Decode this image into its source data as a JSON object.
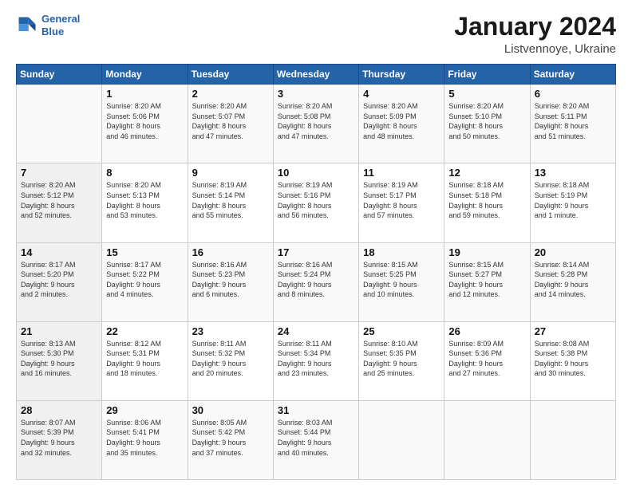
{
  "logo": {
    "line1": "General",
    "line2": "Blue"
  },
  "title": "January 2024",
  "subtitle": "Listvennoye, Ukraine",
  "days_header": [
    "Sunday",
    "Monday",
    "Tuesday",
    "Wednesday",
    "Thursday",
    "Friday",
    "Saturday"
  ],
  "weeks": [
    [
      {
        "day": "",
        "info": ""
      },
      {
        "day": "1",
        "info": "Sunrise: 8:20 AM\nSunset: 5:06 PM\nDaylight: 8 hours\nand 46 minutes."
      },
      {
        "day": "2",
        "info": "Sunrise: 8:20 AM\nSunset: 5:07 PM\nDaylight: 8 hours\nand 47 minutes."
      },
      {
        "day": "3",
        "info": "Sunrise: 8:20 AM\nSunset: 5:08 PM\nDaylight: 8 hours\nand 47 minutes."
      },
      {
        "day": "4",
        "info": "Sunrise: 8:20 AM\nSunset: 5:09 PM\nDaylight: 8 hours\nand 48 minutes."
      },
      {
        "day": "5",
        "info": "Sunrise: 8:20 AM\nSunset: 5:10 PM\nDaylight: 8 hours\nand 50 minutes."
      },
      {
        "day": "6",
        "info": "Sunrise: 8:20 AM\nSunset: 5:11 PM\nDaylight: 8 hours\nand 51 minutes."
      }
    ],
    [
      {
        "day": "7",
        "info": "Sunrise: 8:20 AM\nSunset: 5:12 PM\nDaylight: 8 hours\nand 52 minutes."
      },
      {
        "day": "8",
        "info": "Sunrise: 8:20 AM\nSunset: 5:13 PM\nDaylight: 8 hours\nand 53 minutes."
      },
      {
        "day": "9",
        "info": "Sunrise: 8:19 AM\nSunset: 5:14 PM\nDaylight: 8 hours\nand 55 minutes."
      },
      {
        "day": "10",
        "info": "Sunrise: 8:19 AM\nSunset: 5:16 PM\nDaylight: 8 hours\nand 56 minutes."
      },
      {
        "day": "11",
        "info": "Sunrise: 8:19 AM\nSunset: 5:17 PM\nDaylight: 8 hours\nand 57 minutes."
      },
      {
        "day": "12",
        "info": "Sunrise: 8:18 AM\nSunset: 5:18 PM\nDaylight: 8 hours\nand 59 minutes."
      },
      {
        "day": "13",
        "info": "Sunrise: 8:18 AM\nSunset: 5:19 PM\nDaylight: 9 hours\nand 1 minute."
      }
    ],
    [
      {
        "day": "14",
        "info": "Sunrise: 8:17 AM\nSunset: 5:20 PM\nDaylight: 9 hours\nand 2 minutes."
      },
      {
        "day": "15",
        "info": "Sunrise: 8:17 AM\nSunset: 5:22 PM\nDaylight: 9 hours\nand 4 minutes."
      },
      {
        "day": "16",
        "info": "Sunrise: 8:16 AM\nSunset: 5:23 PM\nDaylight: 9 hours\nand 6 minutes."
      },
      {
        "day": "17",
        "info": "Sunrise: 8:16 AM\nSunset: 5:24 PM\nDaylight: 9 hours\nand 8 minutes."
      },
      {
        "day": "18",
        "info": "Sunrise: 8:15 AM\nSunset: 5:25 PM\nDaylight: 9 hours\nand 10 minutes."
      },
      {
        "day": "19",
        "info": "Sunrise: 8:15 AM\nSunset: 5:27 PM\nDaylight: 9 hours\nand 12 minutes."
      },
      {
        "day": "20",
        "info": "Sunrise: 8:14 AM\nSunset: 5:28 PM\nDaylight: 9 hours\nand 14 minutes."
      }
    ],
    [
      {
        "day": "21",
        "info": "Sunrise: 8:13 AM\nSunset: 5:30 PM\nDaylight: 9 hours\nand 16 minutes."
      },
      {
        "day": "22",
        "info": "Sunrise: 8:12 AM\nSunset: 5:31 PM\nDaylight: 9 hours\nand 18 minutes."
      },
      {
        "day": "23",
        "info": "Sunrise: 8:11 AM\nSunset: 5:32 PM\nDaylight: 9 hours\nand 20 minutes."
      },
      {
        "day": "24",
        "info": "Sunrise: 8:11 AM\nSunset: 5:34 PM\nDaylight: 9 hours\nand 23 minutes."
      },
      {
        "day": "25",
        "info": "Sunrise: 8:10 AM\nSunset: 5:35 PM\nDaylight: 9 hours\nand 25 minutes."
      },
      {
        "day": "26",
        "info": "Sunrise: 8:09 AM\nSunset: 5:36 PM\nDaylight: 9 hours\nand 27 minutes."
      },
      {
        "day": "27",
        "info": "Sunrise: 8:08 AM\nSunset: 5:38 PM\nDaylight: 9 hours\nand 30 minutes."
      }
    ],
    [
      {
        "day": "28",
        "info": "Sunrise: 8:07 AM\nSunset: 5:39 PM\nDaylight: 9 hours\nand 32 minutes."
      },
      {
        "day": "29",
        "info": "Sunrise: 8:06 AM\nSunset: 5:41 PM\nDaylight: 9 hours\nand 35 minutes."
      },
      {
        "day": "30",
        "info": "Sunrise: 8:05 AM\nSunset: 5:42 PM\nDaylight: 9 hours\nand 37 minutes."
      },
      {
        "day": "31",
        "info": "Sunrise: 8:03 AM\nSunset: 5:44 PM\nDaylight: 9 hours\nand 40 minutes."
      },
      {
        "day": "",
        "info": ""
      },
      {
        "day": "",
        "info": ""
      },
      {
        "day": "",
        "info": ""
      }
    ]
  ]
}
